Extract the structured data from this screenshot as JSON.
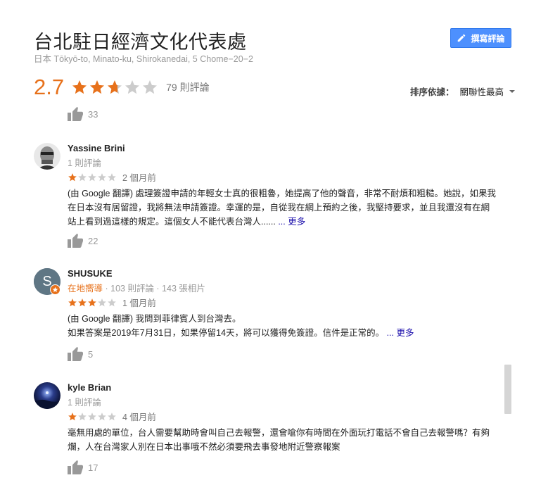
{
  "place": {
    "title": "台北駐日經濟文化代表處",
    "address": "日本 Tōkyō-to, Minato-ku, Shirokanedai, 5 Chome−20−2"
  },
  "write_review_label": "撰寫評論",
  "summary": {
    "rating": "2.7",
    "rating_value": 2.7,
    "review_count": "79 則評論"
  },
  "sort": {
    "label": "排序依據：",
    "value": "關聯性最高"
  },
  "prev_review": {
    "likes": "33"
  },
  "reviews": [
    {
      "name": "Yassine Brini",
      "sub": "1 則評論",
      "stars": 1,
      "date": "2 個月前",
      "text": "(由 Google 翻譯) 處理簽證申請的年輕女士真的很粗魯，她提高了他的聲音，非常不耐煩和粗糙。她說，如果我在日本沒有居留證，我將無法申請簽證。幸運的是，自從我在網上預約之後，我堅持要求，並且我還沒有在網站上看到過這樣的規定。這個女人不能代表台灣人......",
      "ellipsis": "...",
      "more": "更多",
      "likes": "22"
    },
    {
      "name": "SHUSUKE",
      "guide": "在地嚮導",
      "sub": " · 103 則評論 · 143 張相片",
      "avatar_letter": "S",
      "stars": 3,
      "date": "1 個月前",
      "text_line1": "(由 Google 翻譯) 我問到菲律賓人到台灣去。",
      "text_line2": "如果答案是2019年7月31日，如果停留14天，將可以獲得免簽證。信件是正常的。",
      "ellipsis": "...",
      "more": "更多",
      "likes": "5"
    },
    {
      "name": "kyle Brian",
      "sub": "1 則評論",
      "stars": 1,
      "date": "4 個月前",
      "text": "毫無用處的單位，台人需要幫助時會叫自己去報警，還會嗆你有時間在外面玩打電話不會自己去報警嗎？有夠爛，人在台灣家人別在日本出事哦不然必須要飛去事發地附近警察報案",
      "likes": "17"
    }
  ],
  "colors": {
    "accent_orange": "#e7711b",
    "button_blue": "#4d90fe",
    "link_blue": "#1a0dab",
    "star_empty": "#cccccc"
  },
  "icons": [
    "pencil-icon",
    "star-icon",
    "thumbs-up-icon",
    "dropdown-caret-icon",
    "local-guide-badge-icon"
  ]
}
